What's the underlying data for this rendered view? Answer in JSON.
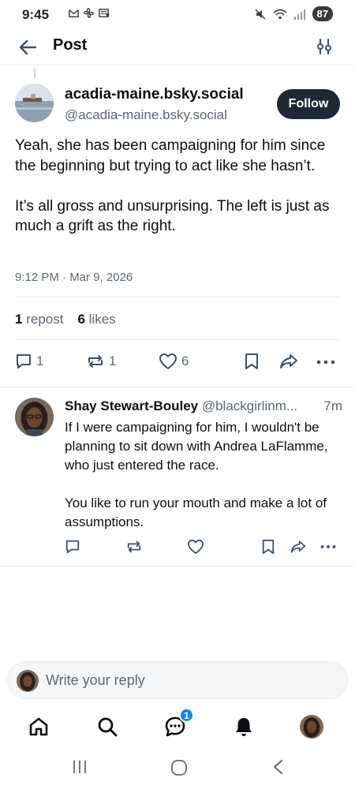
{
  "status_bar": {
    "time": "9:45",
    "battery": "87",
    "dot": "•"
  },
  "header": {
    "title": "Post"
  },
  "post": {
    "author_name": "acadia-maine.bsky.social",
    "author_handle": "@acadia-maine.bsky.social",
    "follow_label": "Follow",
    "paragraphs": [
      "Yeah, she has been campaigning for him since the beginning but trying to act like she hasn’t.",
      "It’s all gross and unsurprising. The left is just as much a grift as the right."
    ],
    "timestamp": "9:12 PM · Mar 9, 2026",
    "repost_count": "1",
    "repost_label": "repost",
    "like_count": "6",
    "like_label": "likes",
    "actions": {
      "reply_count": "1",
      "repost_count": "1",
      "like_count": "6"
    }
  },
  "reply": {
    "author_name": "Shay Stewart-Bouley",
    "author_handle": "@blackgirlinm...",
    "time": "7m",
    "paragraphs": [
      "If I were campaigning for him, I wouldn't be planning to sit down with Andrea LaFlamme, who just entered the race.",
      "You like to run your mouth and make a lot of assumptions."
    ]
  },
  "composer": {
    "placeholder": "Write your reply"
  },
  "bottom_nav": {
    "items": [
      {
        "icon": "home-icon"
      },
      {
        "icon": "search-icon"
      },
      {
        "icon": "chat-icon",
        "badge": "1"
      },
      {
        "icon": "bell-icon"
      },
      {
        "icon": "profile-avatar"
      }
    ]
  },
  "colors": {
    "accent": "#1083fe",
    "follow_bg": "#1e2936",
    "muted_text": "#5b6875"
  }
}
